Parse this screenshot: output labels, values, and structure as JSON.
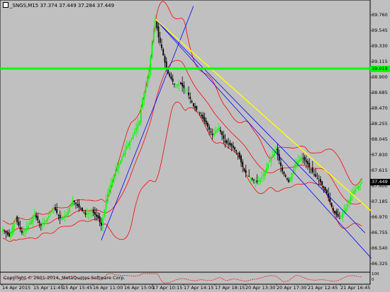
{
  "window": {
    "symbol_line": "_SNGS,M15  37.374 37.449 37.284 37.449"
  },
  "footer": {
    "copyright": "Copyright © 2001-2014, MetaQuotes Software Corp."
  },
  "price_axis": {
    "ticks": [
      "39.760",
      "39.545",
      "39.330",
      "39.115",
      "38.900",
      "38.685",
      "38.470",
      "38.255",
      "38.045",
      "37.830",
      "37.615",
      "37.400",
      "37.185",
      "36.970",
      "36.755",
      "36.540",
      "36.325"
    ],
    "level_label": "39.018",
    "current_label": "37.449"
  },
  "sub_window_axis": {
    "ticks": [
      "100",
      "0"
    ]
  },
  "time_axis": {
    "ticks": [
      "14 Apr 2015",
      "15 Apr 11:45",
      "15 Apr 15:45",
      "16 Apr 11:00",
      "16 Apr 15:00",
      "17 Apr 10:15",
      "17 Apr 14:15",
      "17 Apr 18:15",
      "20 Apr 13:30",
      "20 Apr 17:30",
      "21 Apr 12:45",
      "21 Apr 16:45"
    ]
  },
  "colors": {
    "background": "#c0c0c0",
    "bull_candle": "#00ff00",
    "bear_candle": "#000000",
    "bands": "#ff0000",
    "trend_blue": "#0000ff",
    "trend_yellow": "#ffff00",
    "level_green": "#00ff00"
  },
  "chart_data": {
    "type": "candlestick",
    "symbol": "_SNGS",
    "timeframe": "M15",
    "current_price": 37.449,
    "horizontal_level": 39.018,
    "ylim": [
      36.325,
      39.76
    ],
    "close_path": [
      [
        0,
        36.8
      ],
      [
        4,
        36.7
      ],
      [
        8,
        36.95
      ],
      [
        12,
        36.75
      ],
      [
        16,
        36.85
      ],
      [
        20,
        37.0
      ],
      [
        24,
        36.85
      ],
      [
        28,
        36.95
      ],
      [
        32,
        37.1
      ],
      [
        36,
        36.95
      ],
      [
        40,
        37.0
      ],
      [
        44,
        37.2
      ],
      [
        48,
        37.1
      ],
      [
        52,
        37.0
      ],
      [
        56,
        37.05
      ],
      [
        60,
        36.95
      ],
      [
        62,
        36.85
      ],
      [
        66,
        37.3
      ],
      [
        70,
        37.55
      ],
      [
        74,
        37.75
      ],
      [
        78,
        37.95
      ],
      [
        82,
        38.1
      ],
      [
        86,
        38.3
      ],
      [
        88,
        38.6
      ],
      [
        92,
        38.95
      ],
      [
        94,
        39.4
      ],
      [
        96,
        39.7
      ],
      [
        98,
        39.45
      ],
      [
        100,
        39.3
      ],
      [
        102,
        39.1
      ],
      [
        104,
        38.95
      ],
      [
        108,
        38.8
      ],
      [
        112,
        38.8
      ],
      [
        116,
        38.7
      ],
      [
        120,
        38.5
      ],
      [
        124,
        38.4
      ],
      [
        128,
        38.25
      ],
      [
        132,
        38.1
      ],
      [
        136,
        38.2
      ],
      [
        140,
        38.0
      ],
      [
        144,
        37.95
      ],
      [
        148,
        37.85
      ],
      [
        152,
        37.6
      ],
      [
        156,
        37.5
      ],
      [
        160,
        37.45
      ],
      [
        164,
        37.55
      ],
      [
        168,
        37.75
      ],
      [
        172,
        37.9
      ],
      [
        176,
        37.6
      ],
      [
        180,
        37.45
      ],
      [
        184,
        37.7
      ],
      [
        188,
        37.8
      ],
      [
        192,
        37.7
      ],
      [
        196,
        37.55
      ],
      [
        200,
        37.45
      ],
      [
        204,
        37.3
      ],
      [
        208,
        37.05
      ],
      [
        212,
        36.95
      ],
      [
        216,
        37.1
      ],
      [
        220,
        37.3
      ],
      [
        224,
        37.4
      ],
      [
        226,
        37.449
      ]
    ],
    "trend_lines": [
      {
        "color": "blue",
        "from": [
          62,
          36.65
        ],
        "to": [
          120,
          39.88
        ]
      },
      {
        "color": "blue",
        "from": [
          96,
          39.7
        ],
        "to": [
          232,
          36.4
        ]
      },
      {
        "color": "blue",
        "from": [
          96,
          39.7
        ],
        "to": [
          228,
          36.75
        ]
      },
      {
        "color": "yellow",
        "from": [
          96,
          39.7
        ],
        "to": [
          232,
          37.05
        ]
      }
    ]
  }
}
